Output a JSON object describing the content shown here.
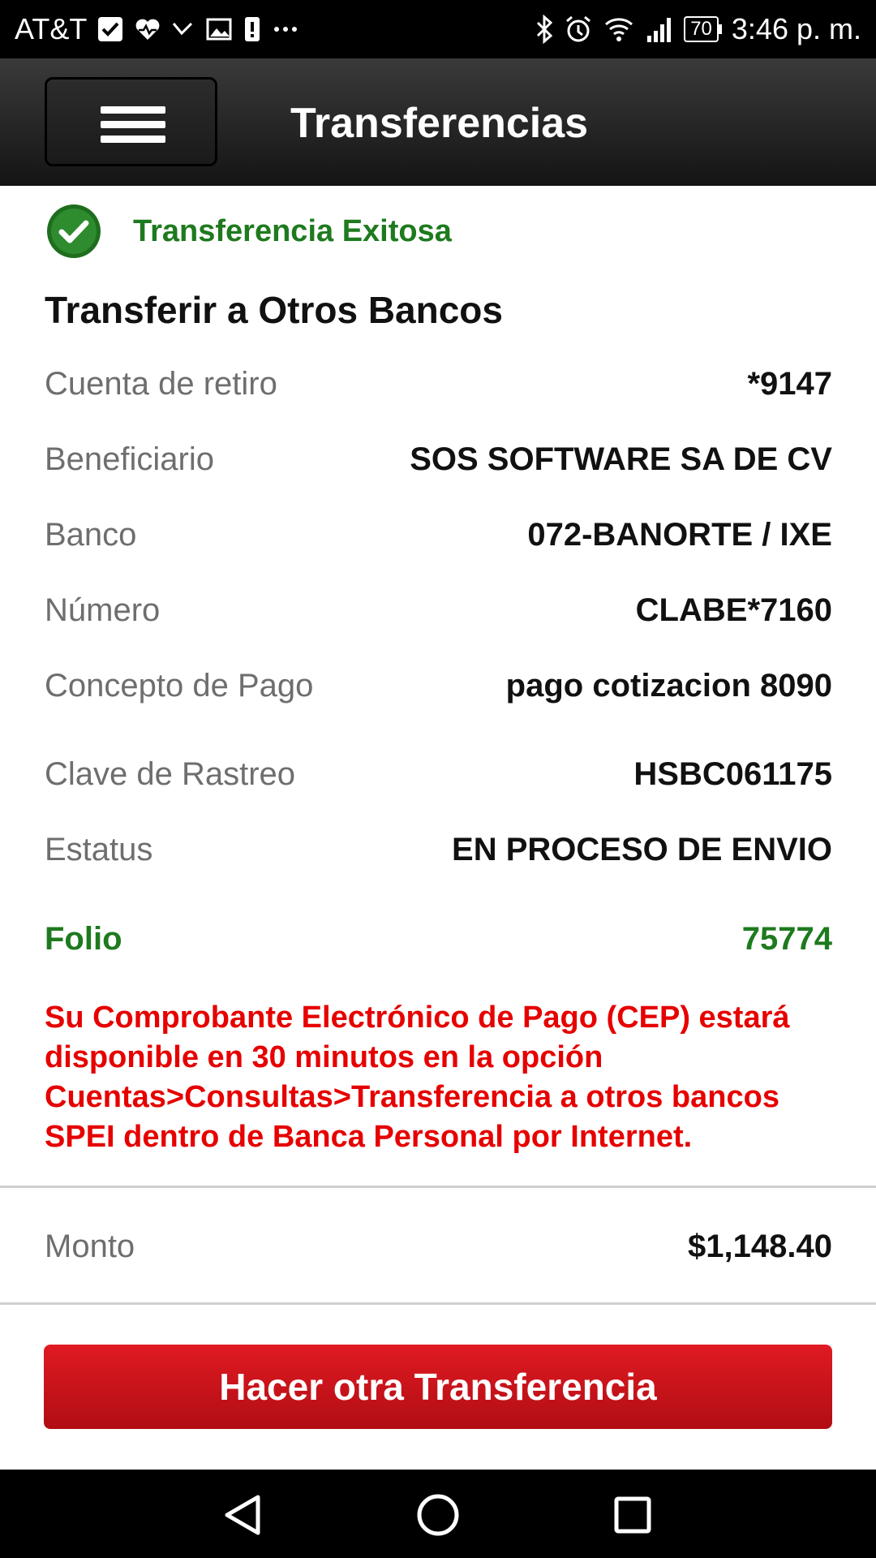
{
  "status_bar": {
    "carrier": "AT&T",
    "battery": "70",
    "time": "3:46 p. m.",
    "left_icons": [
      "check-box-icon",
      "heart-monitor-icon",
      "missed-call-icon",
      "gallery-icon",
      "alert-icon",
      "more-dots-icon"
    ],
    "right_icons": [
      "bluetooth-icon",
      "alarm-icon",
      "wifi-icon",
      "signal-icon",
      "battery-icon"
    ]
  },
  "app_bar": {
    "title": "Transferencias",
    "menu_icon": "hamburger-menu-icon"
  },
  "success": {
    "icon": "check-circle-icon",
    "text": "Transferencia Exitosa",
    "color": "#1e7a1e"
  },
  "section_title": "Transferir a Otros Bancos",
  "details": [
    {
      "label": "Cuenta de retiro",
      "value": "*9147"
    },
    {
      "label": "Beneficiario",
      "value": "SOS SOFTWARE SA DE CV"
    },
    {
      "label": "Banco",
      "value": "072-BANORTE / IXE"
    },
    {
      "label": "Número",
      "value": "CLABE*7160"
    },
    {
      "label": "Concepto de Pago",
      "value": "pago cotizacion 8090"
    },
    {
      "label": "Clave de Rastreo",
      "value": "HSBC061175"
    },
    {
      "label": "Estatus",
      "value": "EN PROCESO DE ENVIO"
    }
  ],
  "folio": {
    "label": "Folio",
    "value": "75774"
  },
  "notice": "Su Comprobante Electrónico de Pago (CEP) estará disponible en 30 minutos en la opción Cuentas>Consultas>Transferencia a otros bancos SPEI dentro de Banca Personal por Internet.",
  "amount": {
    "label": "Monto",
    "value": "$1,148.40"
  },
  "cta": {
    "label": "Hacer otra Transferencia",
    "color": "#c8101a"
  },
  "nav_bar": {
    "icons": [
      "back-icon",
      "home-icon",
      "recents-icon"
    ]
  },
  "colors": {
    "success_green": "#1e7a1e",
    "notice_red": "#e60000",
    "app_bar": "#1f1f1f"
  }
}
